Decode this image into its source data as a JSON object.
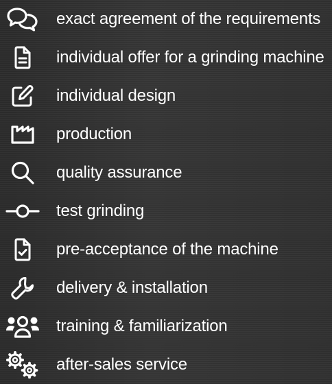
{
  "steps": [
    {
      "icon": "speech-bubbles-icon",
      "label": "exact agreement of the requirements"
    },
    {
      "icon": "document-icon",
      "label": "individual offer for a grinding machine"
    },
    {
      "icon": "pencil-square-icon",
      "label": "individual design"
    },
    {
      "icon": "factory-icon",
      "label": "production"
    },
    {
      "icon": "magnifier-icon",
      "label": "quality assurance"
    },
    {
      "icon": "commit-circle-icon",
      "label": "test grinding"
    },
    {
      "icon": "document-check-icon",
      "label": "pre-acceptance of the machine"
    },
    {
      "icon": "wrench-icon",
      "label": "delivery & installation"
    },
    {
      "icon": "user-group-icon",
      "label": "training & familiarization"
    },
    {
      "icon": "gears-icon",
      "label": "after-sales service"
    }
  ]
}
